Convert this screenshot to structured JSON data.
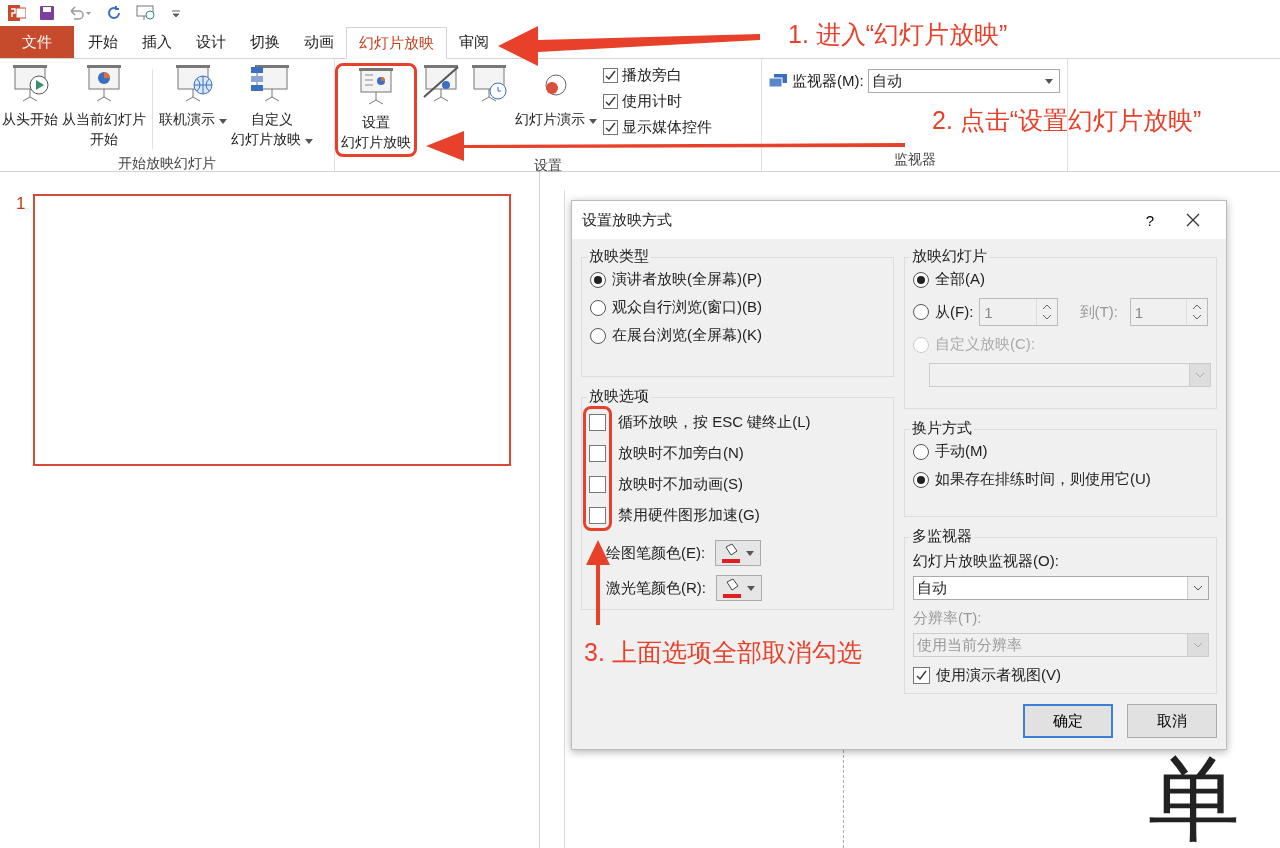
{
  "tabs": [
    {
      "label": "文件",
      "kind": "file",
      "selected": false
    },
    {
      "label": "开始",
      "kind": "tab",
      "selected": false
    },
    {
      "label": "插入",
      "kind": "tab",
      "selected": false
    },
    {
      "label": "设计",
      "kind": "tab",
      "selected": false
    },
    {
      "label": "切换",
      "kind": "tab",
      "selected": false
    },
    {
      "label": "动画",
      "kind": "tab",
      "selected": false
    },
    {
      "label": "幻灯片放映",
      "kind": "tab",
      "selected": true
    },
    {
      "label": "审阅",
      "kind": "tab",
      "selected": false
    }
  ],
  "ribbon": {
    "groups": [
      {
        "label": "开始放映幻灯片",
        "items": [
          {
            "kind": "button",
            "lines": [
              "从头开始"
            ],
            "dropdown": false,
            "annotated": false
          },
          {
            "kind": "button",
            "lines": [
              "从当前幻灯片",
              "开始"
            ],
            "dropdown": false,
            "annotated": false
          },
          {
            "kind": "separator"
          },
          {
            "kind": "button",
            "lines": [
              "联机演示"
            ],
            "dropdown": true,
            "annotated": false
          },
          {
            "kind": "button",
            "lines": [
              "自定义",
              "幻灯片放映"
            ],
            "dropdown": true,
            "annotated": false
          }
        ]
      },
      {
        "label": "设置",
        "items": [
          {
            "kind": "button",
            "lines": [
              "设置",
              "幻灯片放映"
            ],
            "dropdown": false,
            "annotated": true
          },
          {
            "kind": "button",
            "dropdown": false,
            "annotated": false
          },
          {
            "kind": "button",
            "dropdown": false,
            "annotated": false
          },
          {
            "kind": "button",
            "lines": [
              "幻灯片演示"
            ],
            "dropdown": true,
            "annotated": false
          },
          {
            "kind": "checks",
            "checks": [
              {
                "label": "播放旁白",
                "checked": true
              },
              {
                "label": "使用计时",
                "checked": true
              },
              {
                "label": "显示媒体控件",
                "checked": true
              }
            ]
          }
        ]
      },
      {
        "label": "监视器",
        "items": [
          {
            "kind": "monitor",
            "label": "监视器(M):",
            "value": "自动"
          }
        ]
      }
    ]
  },
  "slides": [
    {
      "number": "1",
      "selected": true
    }
  ],
  "slide_text": "单",
  "dialog": {
    "title": "设置放映方式",
    "help": "?",
    "show_type": {
      "title": "放映类型",
      "options": [
        {
          "label": "演讲者放映(全屏幕)(P)",
          "selected": true
        },
        {
          "label": "观众自行浏览(窗口)(B)",
          "selected": false
        },
        {
          "label": "在展台浏览(全屏幕)(K)",
          "selected": false
        }
      ]
    },
    "show_options": {
      "title": "放映选项",
      "annotated": true,
      "checks": [
        {
          "label": "循环放映，按 ESC 键终止(L)",
          "checked": false
        },
        {
          "label": "放映时不加旁白(N)",
          "checked": false
        },
        {
          "label": "放映时不加动画(S)",
          "checked": false
        },
        {
          "label": "禁用硬件图形加速(G)",
          "checked": false
        }
      ],
      "colors": [
        {
          "label": "绘图笔颜色(E):",
          "color": "#e02020"
        },
        {
          "label": "激光笔颜色(R):",
          "color": "#e02020"
        }
      ]
    },
    "show_slides": {
      "title": "放映幻灯片",
      "all": {
        "label": "全部(A)",
        "selected": true
      },
      "range": {
        "label": "从(F):",
        "selected": false,
        "from": "1",
        "to_label": "到(T):",
        "to": "1"
      },
      "custom": {
        "label": "自定义放映(C):",
        "selected": false,
        "disabled": true
      }
    },
    "advance": {
      "title": "换片方式",
      "options": [
        {
          "label": "手动(M)",
          "selected": false
        },
        {
          "label": "如果存在排练时间，则使用它(U)",
          "selected": true
        }
      ]
    },
    "monitors": {
      "title": "多监视器",
      "monitor_label": "幻灯片放映监视器(O):",
      "monitor_value": "自动",
      "resolution_label": "分辨率(T):",
      "resolution_value": "使用当前分辨率",
      "resolution_disabled": true,
      "presenter": {
        "label": "使用演示者视图(V)",
        "checked": true
      }
    },
    "buttons": [
      {
        "label": "确定",
        "default": true
      },
      {
        "label": "取消",
        "default": false
      }
    ]
  },
  "annotations": [
    "1. 进入“幻灯片放映”",
    "2. 点击“设置幻灯片放映”",
    "3. 上面选项全部取消勾选"
  ]
}
